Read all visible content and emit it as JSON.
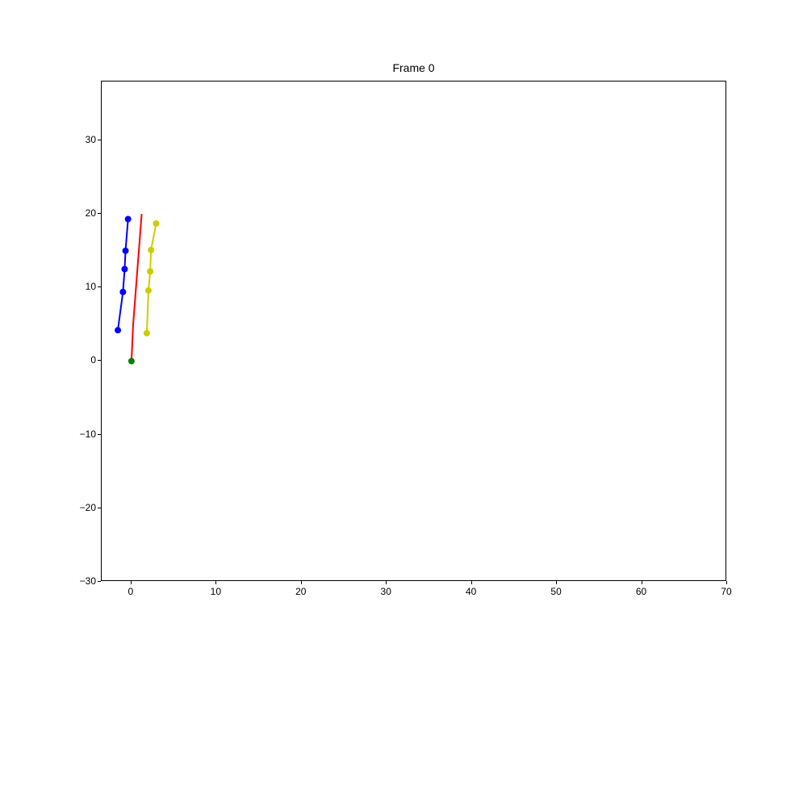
{
  "chart_data": {
    "type": "line",
    "title": "Frame 0",
    "xlabel": "",
    "ylabel": "",
    "xlim": [
      -3.5,
      70
    ],
    "ylim": [
      -30,
      38
    ],
    "x_ticks": [
      0,
      10,
      20,
      30,
      40,
      50,
      60,
      70
    ],
    "y_ticks": [
      -30,
      -20,
      -10,
      0,
      10,
      20,
      30
    ],
    "series": [
      {
        "name": "blue-series",
        "color": "#0000ff",
        "marker": true,
        "x": [
          -1.6,
          -1.0,
          -0.8,
          -0.7,
          -0.4
        ],
        "y": [
          4.2,
          9.4,
          12.5,
          15.0,
          19.3
        ]
      },
      {
        "name": "red-line",
        "color": "#ff0000",
        "marker": false,
        "x": [
          0.0,
          0.2,
          1.2
        ],
        "y": [
          0.0,
          5.0,
          20.0
        ]
      },
      {
        "name": "yellow-series",
        "color": "#cccc00",
        "marker": true,
        "x": [
          1.8,
          2.0,
          2.2,
          2.3,
          2.9
        ],
        "y": [
          3.8,
          9.6,
          12.2,
          15.1,
          18.7
        ]
      },
      {
        "name": "green-point",
        "color": "#008000",
        "marker": true,
        "x": [
          0.0
        ],
        "y": [
          0.0
        ]
      }
    ]
  }
}
